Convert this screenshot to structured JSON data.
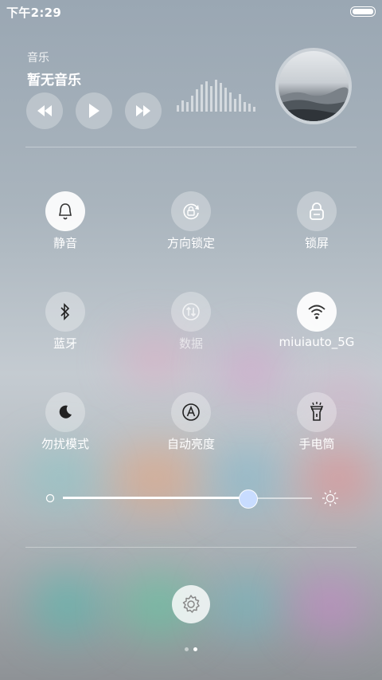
{
  "status_bar": {
    "time": "下午2:29"
  },
  "music": {
    "label": "音乐",
    "title": "暂无音乐",
    "icons": [
      "rewind-icon",
      "play-icon",
      "fast-forward-icon"
    ]
  },
  "toggles": [
    {
      "label": "静音",
      "icon": "bell-icon",
      "active": true
    },
    {
      "label": "方向锁定",
      "icon": "rotation-lock-icon",
      "active": false
    },
    {
      "label": "锁屏",
      "icon": "lock-icon",
      "active": false
    },
    {
      "label": "蓝牙",
      "icon": "bluetooth-icon",
      "active": false
    },
    {
      "label": "数据",
      "icon": "mobile-data-icon",
      "active": false
    },
    {
      "label": "miuiauto_5G",
      "icon": "wifi-icon",
      "active": true
    },
    {
      "label": "勿扰模式",
      "icon": "moon-icon",
      "active": false
    },
    {
      "label": "自动亮度",
      "icon": "auto-brightness-icon",
      "active": false
    },
    {
      "label": "手电筒",
      "icon": "flashlight-icon",
      "active": false
    }
  ],
  "brightness": {
    "level": 0.74,
    "min_icon": "brightness-low-icon",
    "max_icon": "brightness-high-icon"
  },
  "settings_icon": "gear-icon",
  "pager": {
    "count": 2,
    "active": 2
  },
  "colors": {
    "active_toggle": "#ffffff",
    "slider_knob": "#c8dcff"
  }
}
